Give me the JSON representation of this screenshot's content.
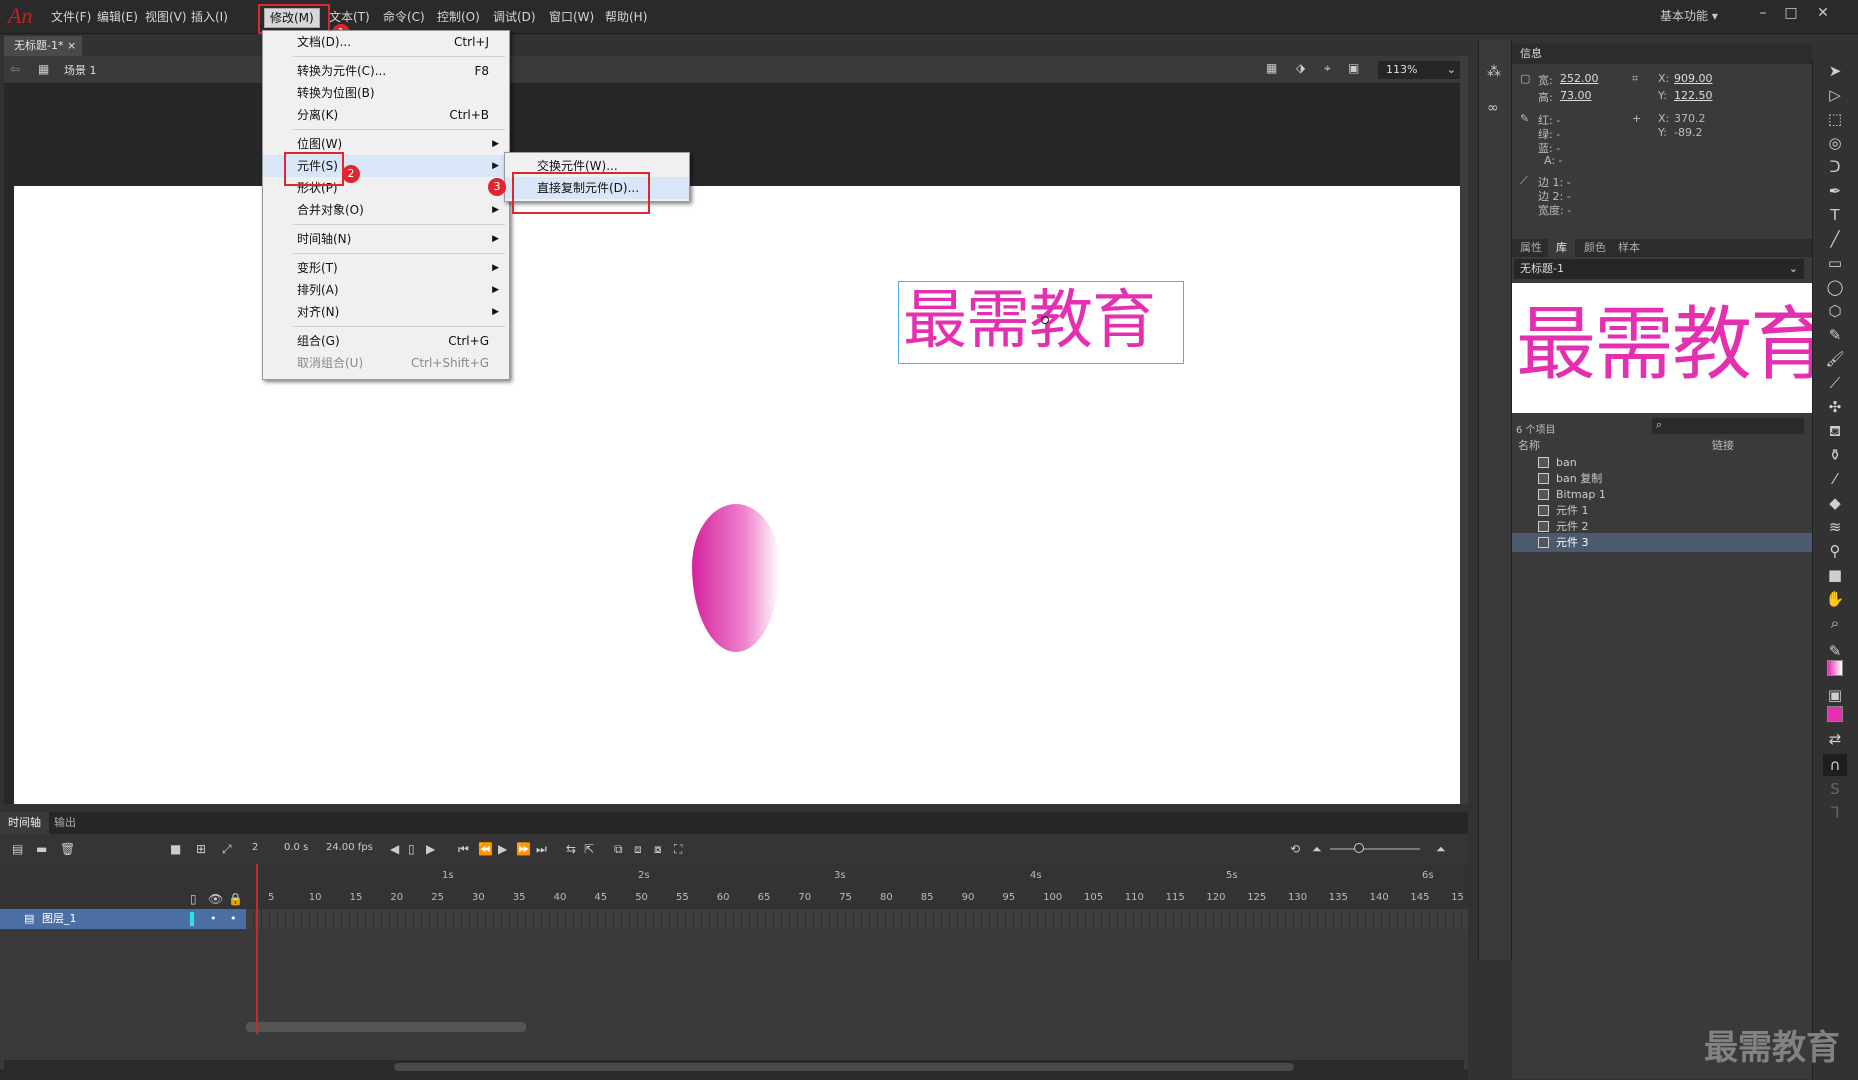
{
  "app": {
    "logo": "An"
  },
  "menubar": {
    "items": [
      "文件(F)",
      "编辑(E)",
      "视图(V)",
      "插入(I)",
      "修改(M)",
      "文本(T)",
      "命令(C)",
      "控制(O)",
      "调试(D)",
      "窗口(W)",
      "帮助(H)"
    ],
    "workspace": "基本功能"
  },
  "document": {
    "tab": "无标题-1*",
    "scene": "场景 1",
    "zoom": "113%"
  },
  "modify_menu": {
    "items": [
      {
        "label": "文档(D)...",
        "shortcut": "Ctrl+J"
      },
      {
        "label": "转换为元件(C)...",
        "shortcut": "F8"
      },
      {
        "label": "转换为位图(B)",
        "shortcut": ""
      },
      {
        "label": "分离(K)",
        "shortcut": "Ctrl+B"
      },
      {
        "label": "位图(W)",
        "shortcut": ""
      },
      {
        "label": "元件(S)",
        "shortcut": ""
      },
      {
        "label": "形状(P)",
        "shortcut": ""
      },
      {
        "label": "合并对象(O)",
        "shortcut": ""
      },
      {
        "label": "时间轴(N)",
        "shortcut": ""
      },
      {
        "label": "变形(T)",
        "shortcut": ""
      },
      {
        "label": "排列(A)",
        "shortcut": ""
      },
      {
        "label": "对齐(N)",
        "shortcut": ""
      },
      {
        "label": "组合(G)",
        "shortcut": "Ctrl+G"
      },
      {
        "label": "取消组合(U)",
        "shortcut": "Ctrl+Shift+G"
      }
    ]
  },
  "symbol_submenu": {
    "items": [
      "交换元件(W)...",
      "直接复制元件(D)..."
    ]
  },
  "callouts": [
    "1",
    "2",
    "3"
  ],
  "stage": {
    "text": "最需教育"
  },
  "info_panel": {
    "title": "信息",
    "w_label": "宽:",
    "w_value": "252.00",
    "h_label": "高:",
    "h_value": "73.00",
    "x_label": "X:",
    "x_value": "909.00",
    "y_label": "Y:",
    "y_value": "122.50",
    "r_label": "红: -",
    "g_label": "绿: -",
    "b_label": "蓝: -",
    "a_label": "A: -",
    "mx_label": "X:",
    "mx_value": "370.2",
    "my_label": "Y:",
    "my_value": "-89.2",
    "edge1": "边 1: -",
    "edge2": "边 2: -",
    "width": "宽度: -"
  },
  "library_panel": {
    "tabs": [
      "属性",
      "库",
      "颜色",
      "样本"
    ],
    "doc": "无标题-1",
    "preview_text": "最需教育",
    "count": "6 个项目",
    "col_name": "名称",
    "col_link": "链接",
    "items": [
      "ban",
      "ban 复制",
      "Bitmap 1",
      "元件 1",
      "元件 2",
      "元件 3"
    ]
  },
  "timeline": {
    "tabs": [
      "时间轴",
      "输出"
    ],
    "frame": "2",
    "time": "0.0 s",
    "fps": "24.00 fps",
    "layer": "图层_1",
    "seconds": [
      "1s",
      "2s",
      "3s",
      "4s",
      "5s",
      "6s"
    ],
    "frames": [
      "5",
      "10",
      "15",
      "20",
      "25",
      "30",
      "35",
      "40",
      "45",
      "50",
      "55",
      "60",
      "65",
      "70",
      "75",
      "80",
      "85",
      "90",
      "95",
      "100",
      "105",
      "110",
      "115",
      "120",
      "125",
      "130",
      "135",
      "140",
      "145",
      "15"
    ]
  },
  "watermark": "最需教育",
  "colors": {
    "accent_red": "#e0262f",
    "magenta": "#e32fb0",
    "selection": "#4b5a6e"
  }
}
